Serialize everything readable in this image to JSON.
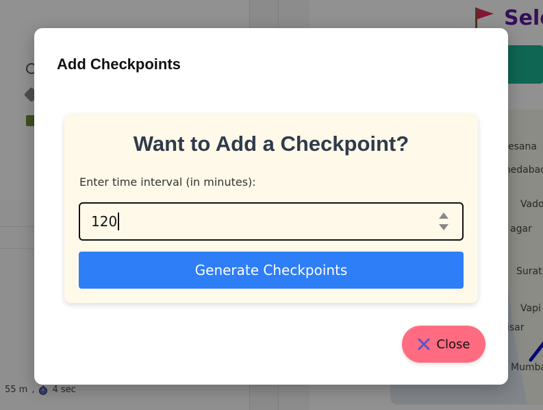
{
  "background": {
    "page_heading_partial": "Sele",
    "map_labels": [
      "esana",
      "medabad",
      "Vado",
      "agar",
      "Surat",
      "Vapi",
      "isar",
      "Mumba"
    ],
    "stat_distance": "55 m",
    "stat_separator": ",",
    "stat_time": "4 sec"
  },
  "modal": {
    "title": "Add Checkpoints",
    "card": {
      "heading": "Want to Add a Checkpoint?",
      "interval_label": "Enter time interval (in minutes):",
      "interval_value": "120",
      "generate_label": "Generate Checkpoints"
    },
    "close_label": "Close"
  },
  "colors": {
    "generate_button": "#2d7ef7",
    "close_button": "#ff6b81",
    "card_background": "#fef9e8",
    "heading_text": "#2f3a4c",
    "background_heading": "#5b1a98",
    "teal_bar": "#19b08f"
  },
  "icons": [
    "flag-icon",
    "spinner-up-icon",
    "spinner-down-icon",
    "close-x-icon",
    "stopwatch-icon"
  ]
}
